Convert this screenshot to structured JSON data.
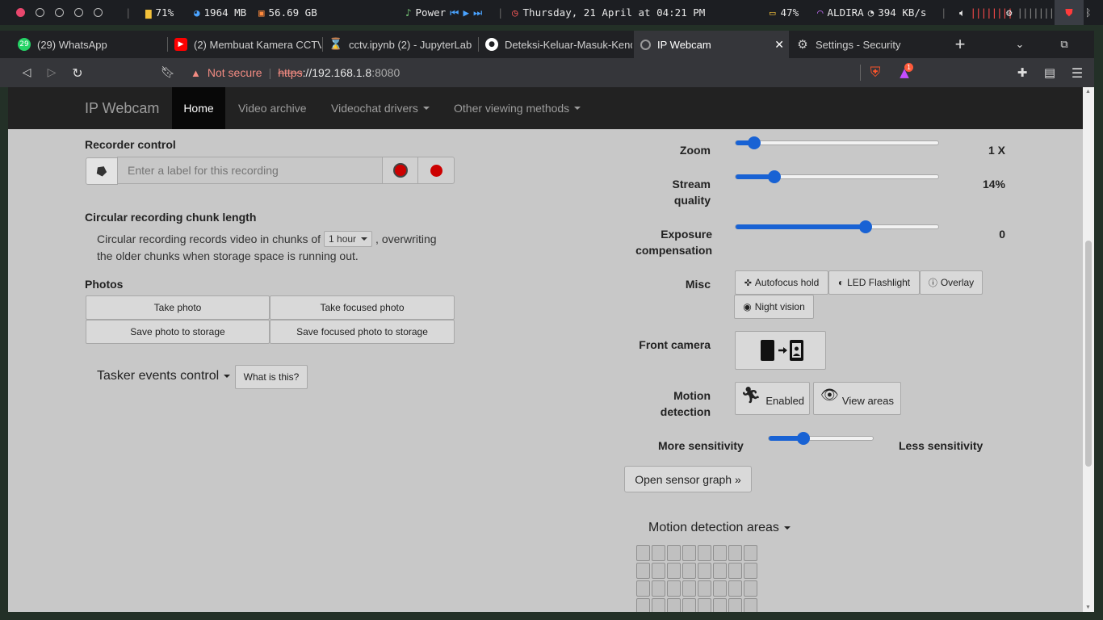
{
  "system_bar": {
    "cpu": "71%",
    "memory": "1964 MB",
    "disk": "56.69 GB",
    "media_title": "Power",
    "datetime": "Thursday, 21 April at 04:21 PM",
    "battery": "47%",
    "wifi_name": "ALDIRA",
    "net_speed": "394 KB/s"
  },
  "tabs": [
    {
      "title": "(29) WhatsApp",
      "favicon": "whatsapp-icon",
      "badge": "29"
    },
    {
      "title": "(2) Membuat Kamera CCTV",
      "favicon": "youtube-icon"
    },
    {
      "title": "cctv.ipynb (2) - JupyterLab",
      "favicon": "jupyter-icon"
    },
    {
      "title": "Deteksi-Keluar-Masuk-Kend",
      "favicon": "github-icon"
    },
    {
      "title": "IP Webcam",
      "favicon": "globe-icon",
      "active": true
    },
    {
      "title": "Settings - Security",
      "favicon": "gear-icon"
    }
  ],
  "address_bar": {
    "security_label": "Not secure",
    "scheme": "https",
    "host": "://192.168.1.8",
    "port": ":8080",
    "notification_count": "1"
  },
  "navbar": {
    "brand": "IP Webcam",
    "home": "Home",
    "video_archive": "Video archive",
    "videochat_drivers": "Videochat drivers",
    "other_viewing": "Other viewing methods"
  },
  "recorder": {
    "heading": "Recorder control",
    "placeholder": "Enter a label for this recording"
  },
  "circular": {
    "heading": "Circular recording chunk length",
    "text_before": "Circular recording records video in chunks of",
    "chunk_value": "1 hour",
    "text_after": ", overwriting",
    "text_line2": "the older chunks when storage space is running out."
  },
  "photos": {
    "heading": "Photos",
    "take_photo": "Take photo",
    "take_focused": "Take focused photo",
    "save_photo": "Save photo to storage",
    "save_focused": "Save focused photo to storage"
  },
  "tasker": {
    "label": "Tasker events control",
    "help": "What is this?"
  },
  "controls": {
    "zoom": {
      "label": "Zoom",
      "value": "1 X",
      "fraction": 0.09
    },
    "quality": {
      "label1": "Stream",
      "label2": "quality",
      "value": "14%",
      "fraction": 0.19
    },
    "exposure": {
      "label1": "Exposure",
      "label2": "compensation",
      "value": "0",
      "fraction": 0.64
    },
    "misc": {
      "label": "Misc",
      "autofocus": "Autofocus hold",
      "led": "LED Flashlight",
      "overlay": "Overlay",
      "night": "Night vision"
    },
    "front_camera": {
      "label": "Front camera"
    },
    "motion": {
      "label1": "Motion",
      "label2": "detection",
      "enabled": "Enabled",
      "view_areas": "View areas"
    },
    "sensitivity": {
      "more": "More sensitivity",
      "less": "Less sensitivity",
      "fraction": 0.33
    },
    "sensor_graph": "Open sensor graph »",
    "areas": "Motion detection areas"
  }
}
